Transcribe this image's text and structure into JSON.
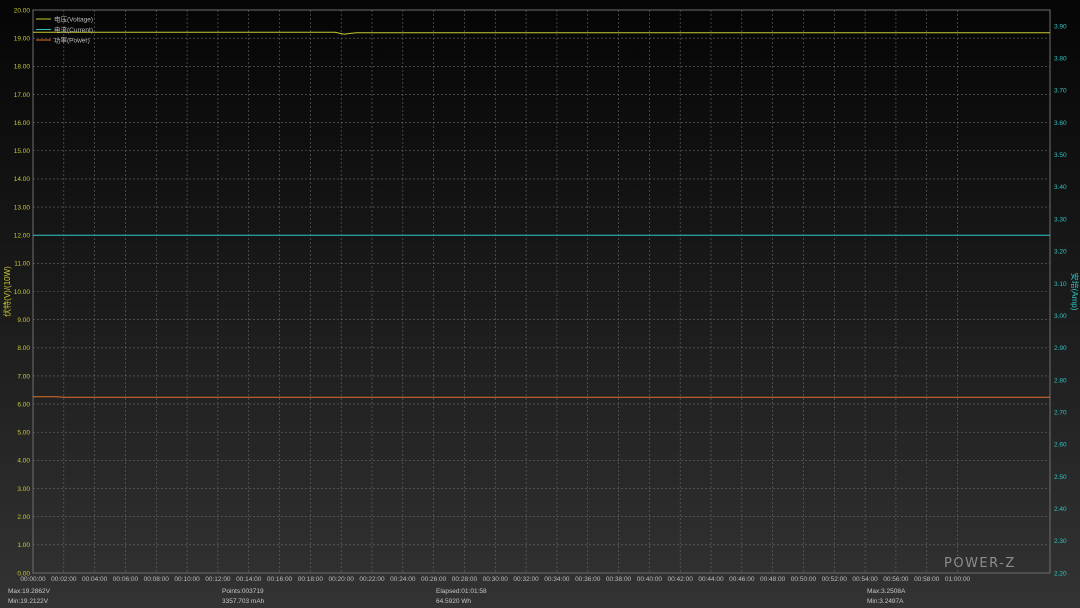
{
  "chart_data": {
    "type": "line",
    "x": [
      "00:00:00",
      "00:02:00",
      "00:04:00",
      "00:06:00",
      "00:08:00",
      "00:10:00",
      "00:12:00",
      "00:14:00",
      "00:16:00",
      "00:18:00",
      "00:20:00",
      "00:22:00",
      "00:24:00",
      "00:26:00",
      "00:28:00",
      "00:30:00",
      "00:32:00",
      "00:34:00",
      "00:36:00",
      "00:38:00",
      "00:40:00",
      "00:42:00",
      "00:44:00",
      "00:46:00",
      "00:48:00",
      "00:50:00",
      "00:52:00",
      "00:54:00",
      "00:56:00",
      "00:58:00",
      "01:00:00"
    ],
    "xlim_minutes": [
      0,
      66
    ],
    "y_left": {
      "label": "伏特(V)/(10W)",
      "ylim": [
        0,
        20
      ],
      "ticks": [
        "0.00",
        "1.00",
        "2.00",
        "3.00",
        "4.00",
        "5.00",
        "6.00",
        "7.00",
        "8.00",
        "9.00",
        "10.00",
        "11.00",
        "12.00",
        "13.00",
        "14.00",
        "15.00",
        "16.00",
        "17.00",
        "18.00",
        "19.00",
        "20.00"
      ],
      "color": "#c8c832"
    },
    "y_right": {
      "label": "安培(Amp)",
      "ylim": [
        2.2,
        3.95
      ],
      "ticks": [
        "2.20",
        "2.30",
        "2.40",
        "2.50",
        "2.60",
        "2.70",
        "2.80",
        "2.90",
        "3.00",
        "3.10",
        "3.20",
        "3.30",
        "3.40",
        "3.50",
        "3.60",
        "3.70",
        "3.80",
        "3.90"
      ],
      "color": "#2fc4c4"
    },
    "grid": true,
    "legend_position": "top-left",
    "series": [
      {
        "name": "电压(Voltage)",
        "axis": "left",
        "color": "#c8c832",
        "x": [
          0,
          19.6,
          20.2,
          20.6,
          21.0,
          66
        ],
        "y": [
          19.21,
          19.21,
          19.14,
          19.17,
          19.19,
          19.19
        ]
      },
      {
        "name": "电流(Current)",
        "axis": "right",
        "color": "#2fc4c4",
        "x": [
          0,
          66
        ],
        "y": [
          3.25,
          3.25
        ]
      },
      {
        "name": "功率(Power)",
        "axis": "left",
        "color": "#e0702a",
        "x": [
          0,
          1.5,
          2.0,
          66
        ],
        "y": [
          6.26,
          6.26,
          6.24,
          6.24
        ]
      }
    ]
  },
  "stats": {
    "voltage_max": "Max:19.2862V",
    "voltage_min": "Min:19.2122V",
    "points": "Points:003719",
    "capacity": "3357.703 mAh",
    "elapsed": "Elapsed:01:01:58",
    "energy": "64.5920 Wh",
    "current_max": "Max:3.2508A",
    "current_min": "Min:3.2497A"
  },
  "brand": "POWER-Z"
}
